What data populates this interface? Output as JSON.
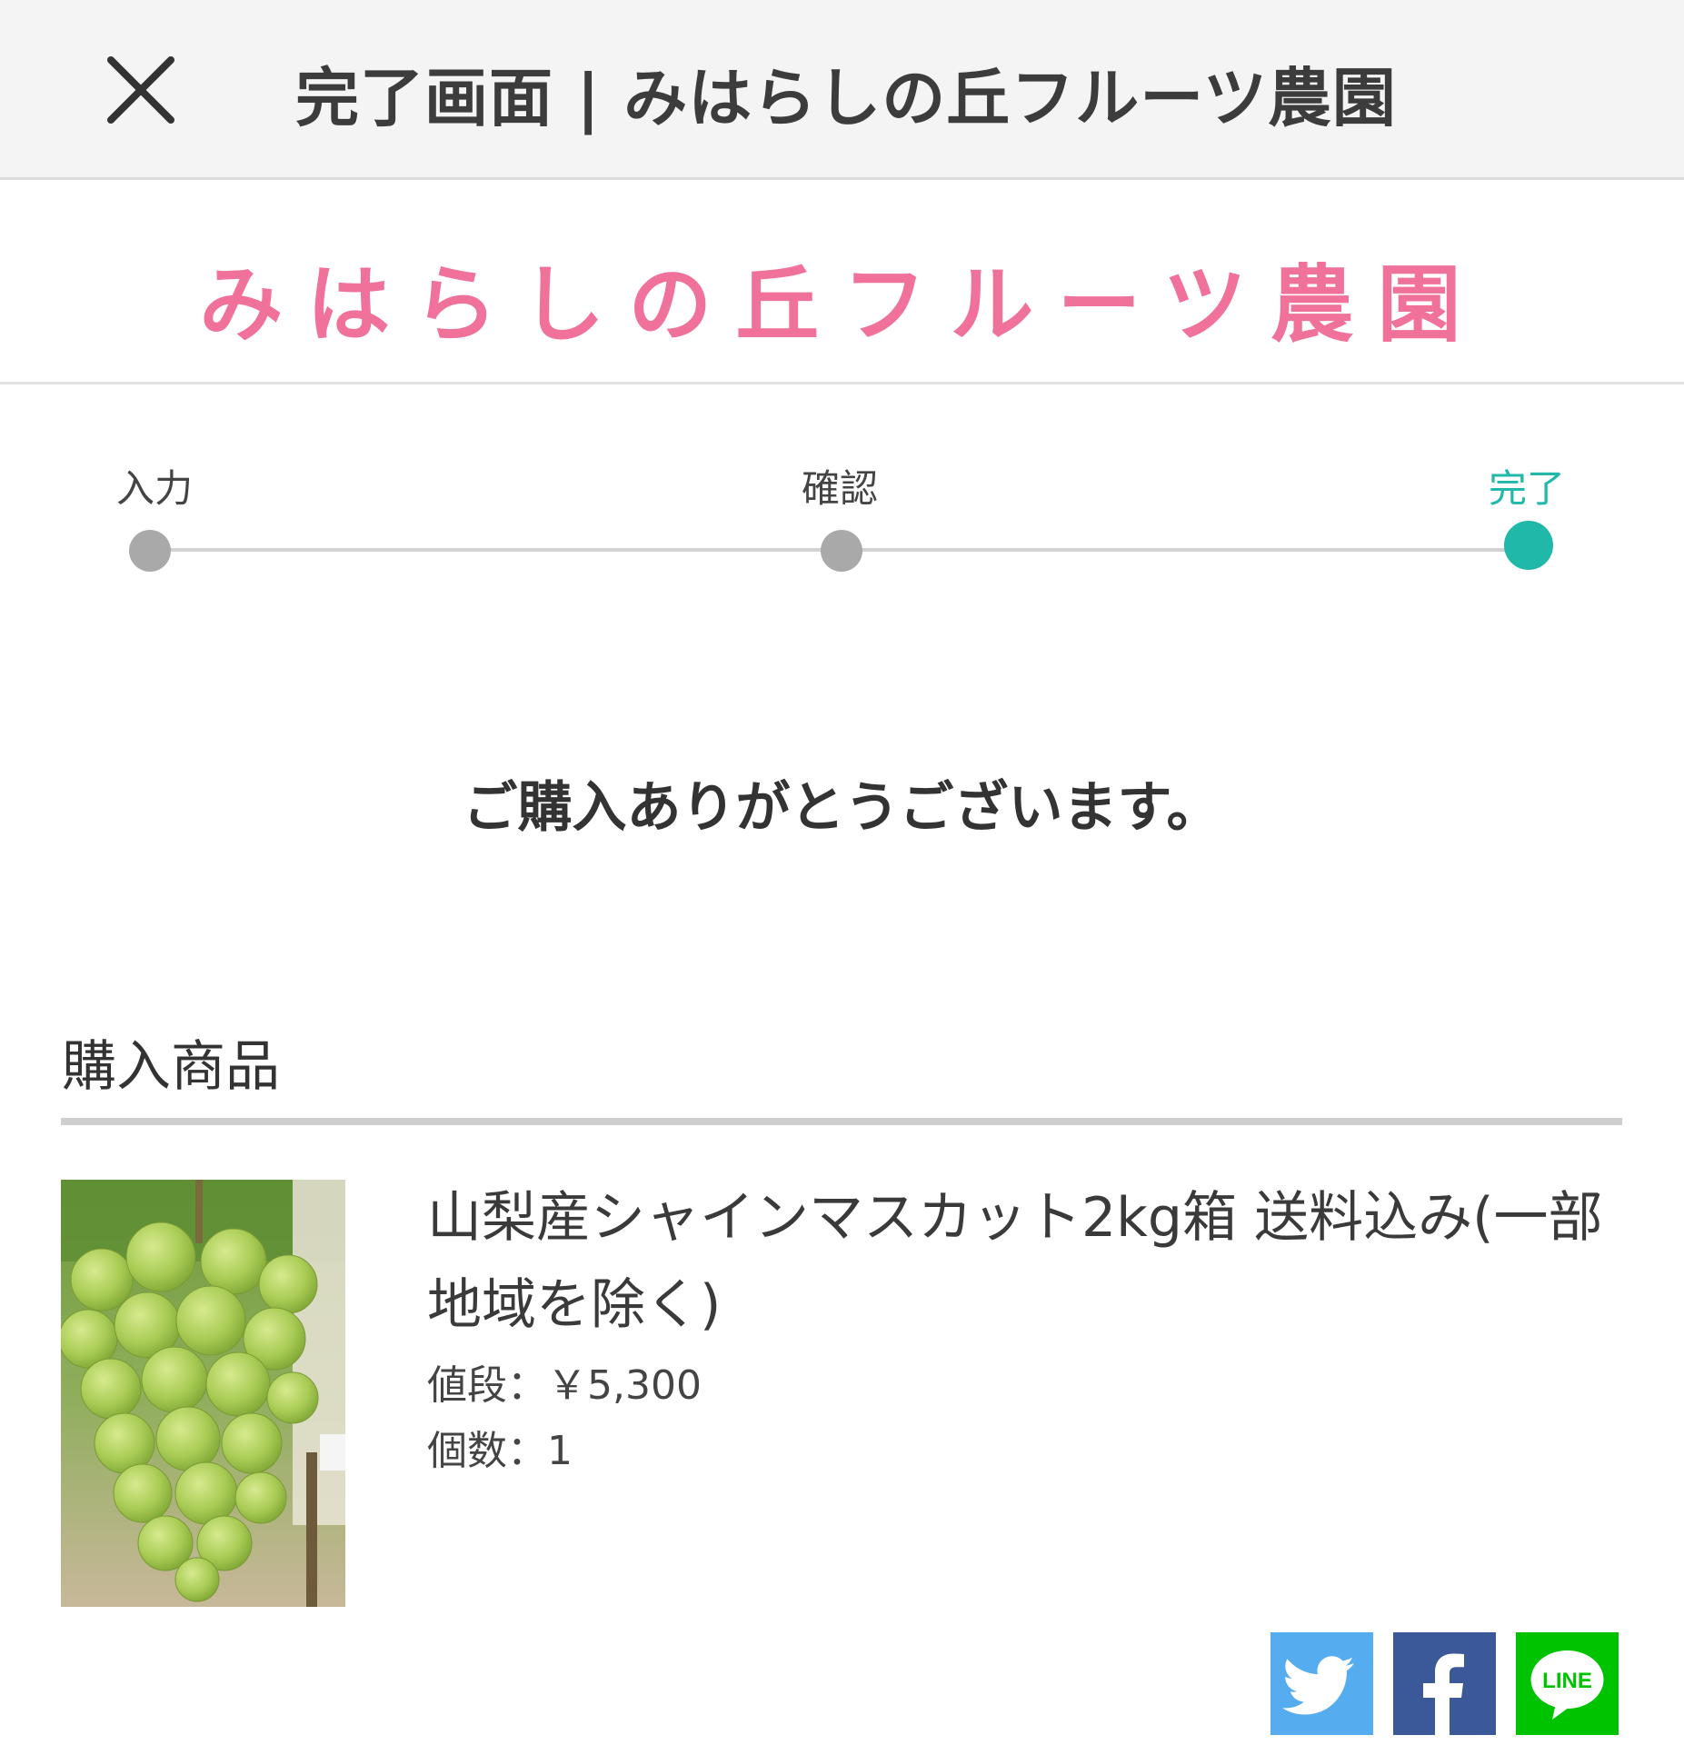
{
  "header": {
    "title": "完了画面 | みはらしの丘フルーツ農園",
    "close_icon": "close-icon"
  },
  "logo": {
    "text": "みはらしの丘フルーツ農園",
    "color": "#f0719a"
  },
  "stepper": {
    "steps": [
      {
        "label": "入力",
        "state": "done"
      },
      {
        "label": "確認",
        "state": "done"
      },
      {
        "label": "完了",
        "state": "current"
      }
    ],
    "active_color": "#1fb8a9",
    "inactive_color": "#a9a9a9"
  },
  "message": "ご購入ありがとうございます。",
  "purchased": {
    "section_title": "購入商品",
    "items": [
      {
        "name": "山梨産シャインマスカット2kg箱 送料込み(一部地域を除く)",
        "price": "値段：￥5,300",
        "quantity": "個数：1",
        "image": "grape-bunch-photo"
      }
    ]
  },
  "share": {
    "buttons": [
      {
        "service": "twitter",
        "icon": "twitter-bird-icon",
        "color": "#55acee"
      },
      {
        "service": "facebook",
        "icon": "facebook-f-icon",
        "color": "#3b5998"
      },
      {
        "service": "line",
        "icon": "line-icon",
        "label": "LINE",
        "color": "#00c300"
      }
    ]
  }
}
